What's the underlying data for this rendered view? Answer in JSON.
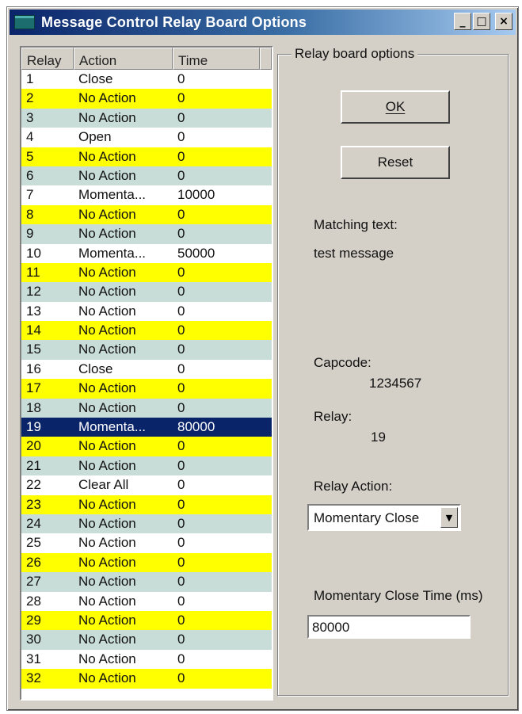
{
  "window": {
    "title": "Message Control Relay Board Options",
    "minimize": "_",
    "maximize": "□",
    "close": "×"
  },
  "list": {
    "headers": {
      "relay": "Relay",
      "action": "Action",
      "time": "Time"
    },
    "rows": [
      {
        "relay": "1",
        "action": "Close",
        "time": "0",
        "style": "white"
      },
      {
        "relay": "2",
        "action": "No Action",
        "time": "0",
        "style": "yellow"
      },
      {
        "relay": "3",
        "action": "No Action",
        "time": "0",
        "style": "teal"
      },
      {
        "relay": "4",
        "action": "Open",
        "time": "0",
        "style": "white"
      },
      {
        "relay": "5",
        "action": "No Action",
        "time": "0",
        "style": "yellow"
      },
      {
        "relay": "6",
        "action": "No Action",
        "time": "0",
        "style": "teal"
      },
      {
        "relay": "7",
        "action": "Momenta...",
        "time": "10000",
        "style": "white"
      },
      {
        "relay": "8",
        "action": "No Action",
        "time": "0",
        "style": "yellow"
      },
      {
        "relay": "9",
        "action": "No Action",
        "time": "0",
        "style": "teal"
      },
      {
        "relay": "10",
        "action": "Momenta...",
        "time": "50000",
        "style": "white"
      },
      {
        "relay": "11",
        "action": "No Action",
        "time": "0",
        "style": "yellow"
      },
      {
        "relay": "12",
        "action": "No Action",
        "time": "0",
        "style": "teal"
      },
      {
        "relay": "13",
        "action": "No Action",
        "time": "0",
        "style": "white"
      },
      {
        "relay": "14",
        "action": "No Action",
        "time": "0",
        "style": "yellow"
      },
      {
        "relay": "15",
        "action": "No Action",
        "time": "0",
        "style": "teal"
      },
      {
        "relay": "16",
        "action": "Close",
        "time": "0",
        "style": "white"
      },
      {
        "relay": "17",
        "action": "No Action",
        "time": "0",
        "style": "yellow"
      },
      {
        "relay": "18",
        "action": "No Action",
        "time": "0",
        "style": "teal"
      },
      {
        "relay": "19",
        "action": "Momenta...",
        "time": "80000",
        "style": "selected"
      },
      {
        "relay": "20",
        "action": "No Action",
        "time": "0",
        "style": "yellow"
      },
      {
        "relay": "21",
        "action": "No Action",
        "time": "0",
        "style": "teal"
      },
      {
        "relay": "22",
        "action": "Clear All",
        "time": "0",
        "style": "white"
      },
      {
        "relay": "23",
        "action": "No Action",
        "time": "0",
        "style": "yellow"
      },
      {
        "relay": "24",
        "action": "No Action",
        "time": "0",
        "style": "teal"
      },
      {
        "relay": "25",
        "action": "No Action",
        "time": "0",
        "style": "white"
      },
      {
        "relay": "26",
        "action": "No Action",
        "time": "0",
        "style": "yellow"
      },
      {
        "relay": "27",
        "action": "No Action",
        "time": "0",
        "style": "teal"
      },
      {
        "relay": "28",
        "action": "No Action",
        "time": "0",
        "style": "white"
      },
      {
        "relay": "29",
        "action": "No Action",
        "time": "0",
        "style": "yellow"
      },
      {
        "relay": "30",
        "action": "No Action",
        "time": "0",
        "style": "teal"
      },
      {
        "relay": "31",
        "action": "No Action",
        "time": "0",
        "style": "white"
      },
      {
        "relay": "32",
        "action": "No Action",
        "time": "0",
        "style": "yellow"
      }
    ]
  },
  "options": {
    "group_label": "Relay board options",
    "ok_label": "OK",
    "reset_label": "Reset",
    "matching_text_label": "Matching text:",
    "matching_text_value": "test message",
    "capcode_label": "Capcode:",
    "capcode_value": "1234567",
    "relay_label": "Relay:",
    "relay_value": "19",
    "relay_action_label": "Relay Action:",
    "relay_action_value": "Momentary Close",
    "momentary_time_label": "Momentary Close Time (ms)",
    "momentary_time_value": "80000"
  },
  "colors": {
    "title_start": "#0a246a",
    "title_end": "#a6caf0",
    "row_yellow": "#ffff00",
    "row_teal": "#c8dcd8",
    "row_selected": "#0a246a",
    "face": "#d4d0c8"
  }
}
